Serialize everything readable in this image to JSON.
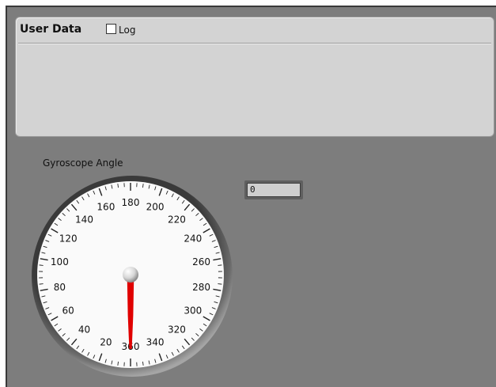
{
  "user_data": {
    "title": "User Data",
    "log_label": "Log",
    "log_checked": false
  },
  "gyro": {
    "title": "Gyroscope Angle",
    "value": 0,
    "readout": "0",
    "needle_color": "#e00000",
    "scale_min": 0,
    "scale_max": 360,
    "major_step": 20,
    "minor_step": 4,
    "labels": [
      "20",
      "40",
      "60",
      "80",
      "100",
      "120",
      "140",
      "160",
      "180",
      "200",
      "220",
      "240",
      "260",
      "280",
      "300",
      "320",
      "340",
      "360"
    ]
  }
}
